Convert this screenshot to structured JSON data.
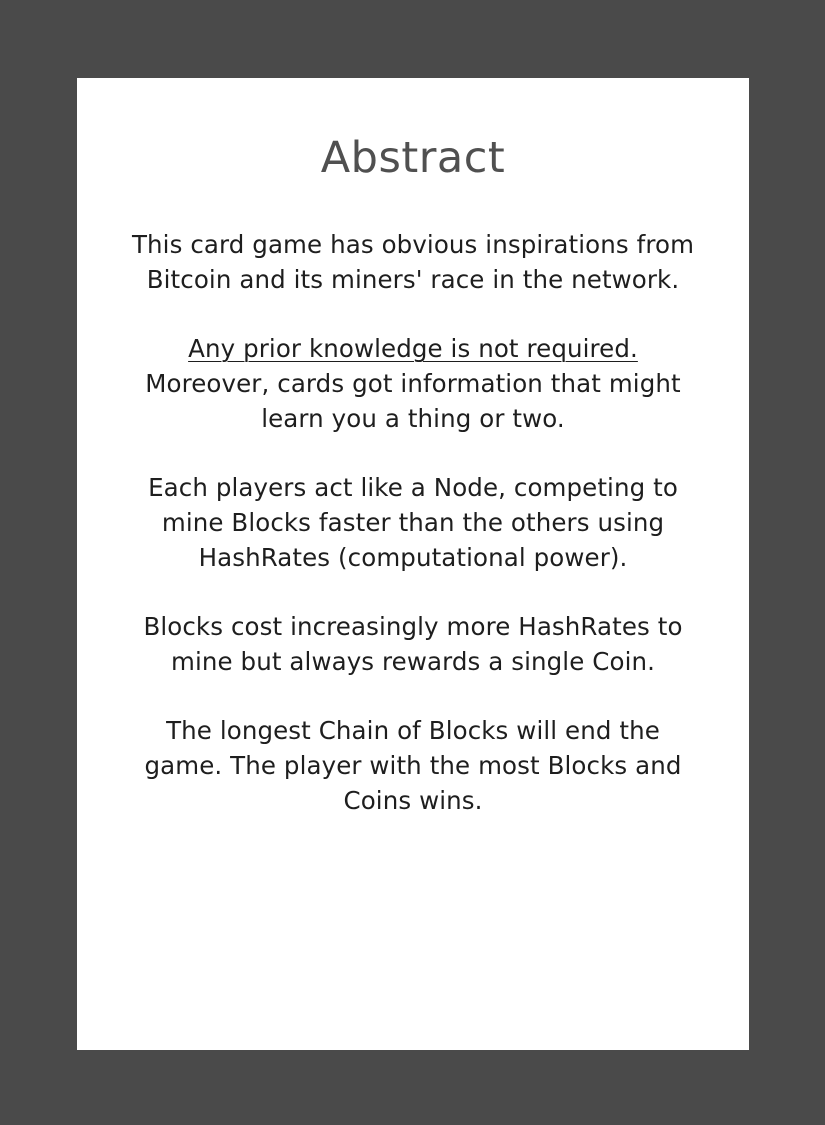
{
  "title": "Abstract",
  "paragraphs": [
    {
      "lines": [
        "This card game has obvious inspirations from",
        "Bitcoin and its miners' race in the network."
      ]
    },
    {
      "emphasis": "Any prior knowledge is not required.",
      "lines": [
        "Moreover, cards got information that might",
        "learn you a thing or two."
      ]
    },
    {
      "lines": [
        "Each players act like a Node, competing to",
        "mine Blocks faster than the others using",
        "HashRates (computational power)."
      ]
    },
    {
      "lines": [
        "Blocks cost increasingly more HashRates to",
        "mine but always rewards a single Coin."
      ]
    },
    {
      "lines": [
        "The longest Chain of Blocks will end the",
        "game. The player with the most Blocks and",
        "Coins wins."
      ]
    }
  ]
}
